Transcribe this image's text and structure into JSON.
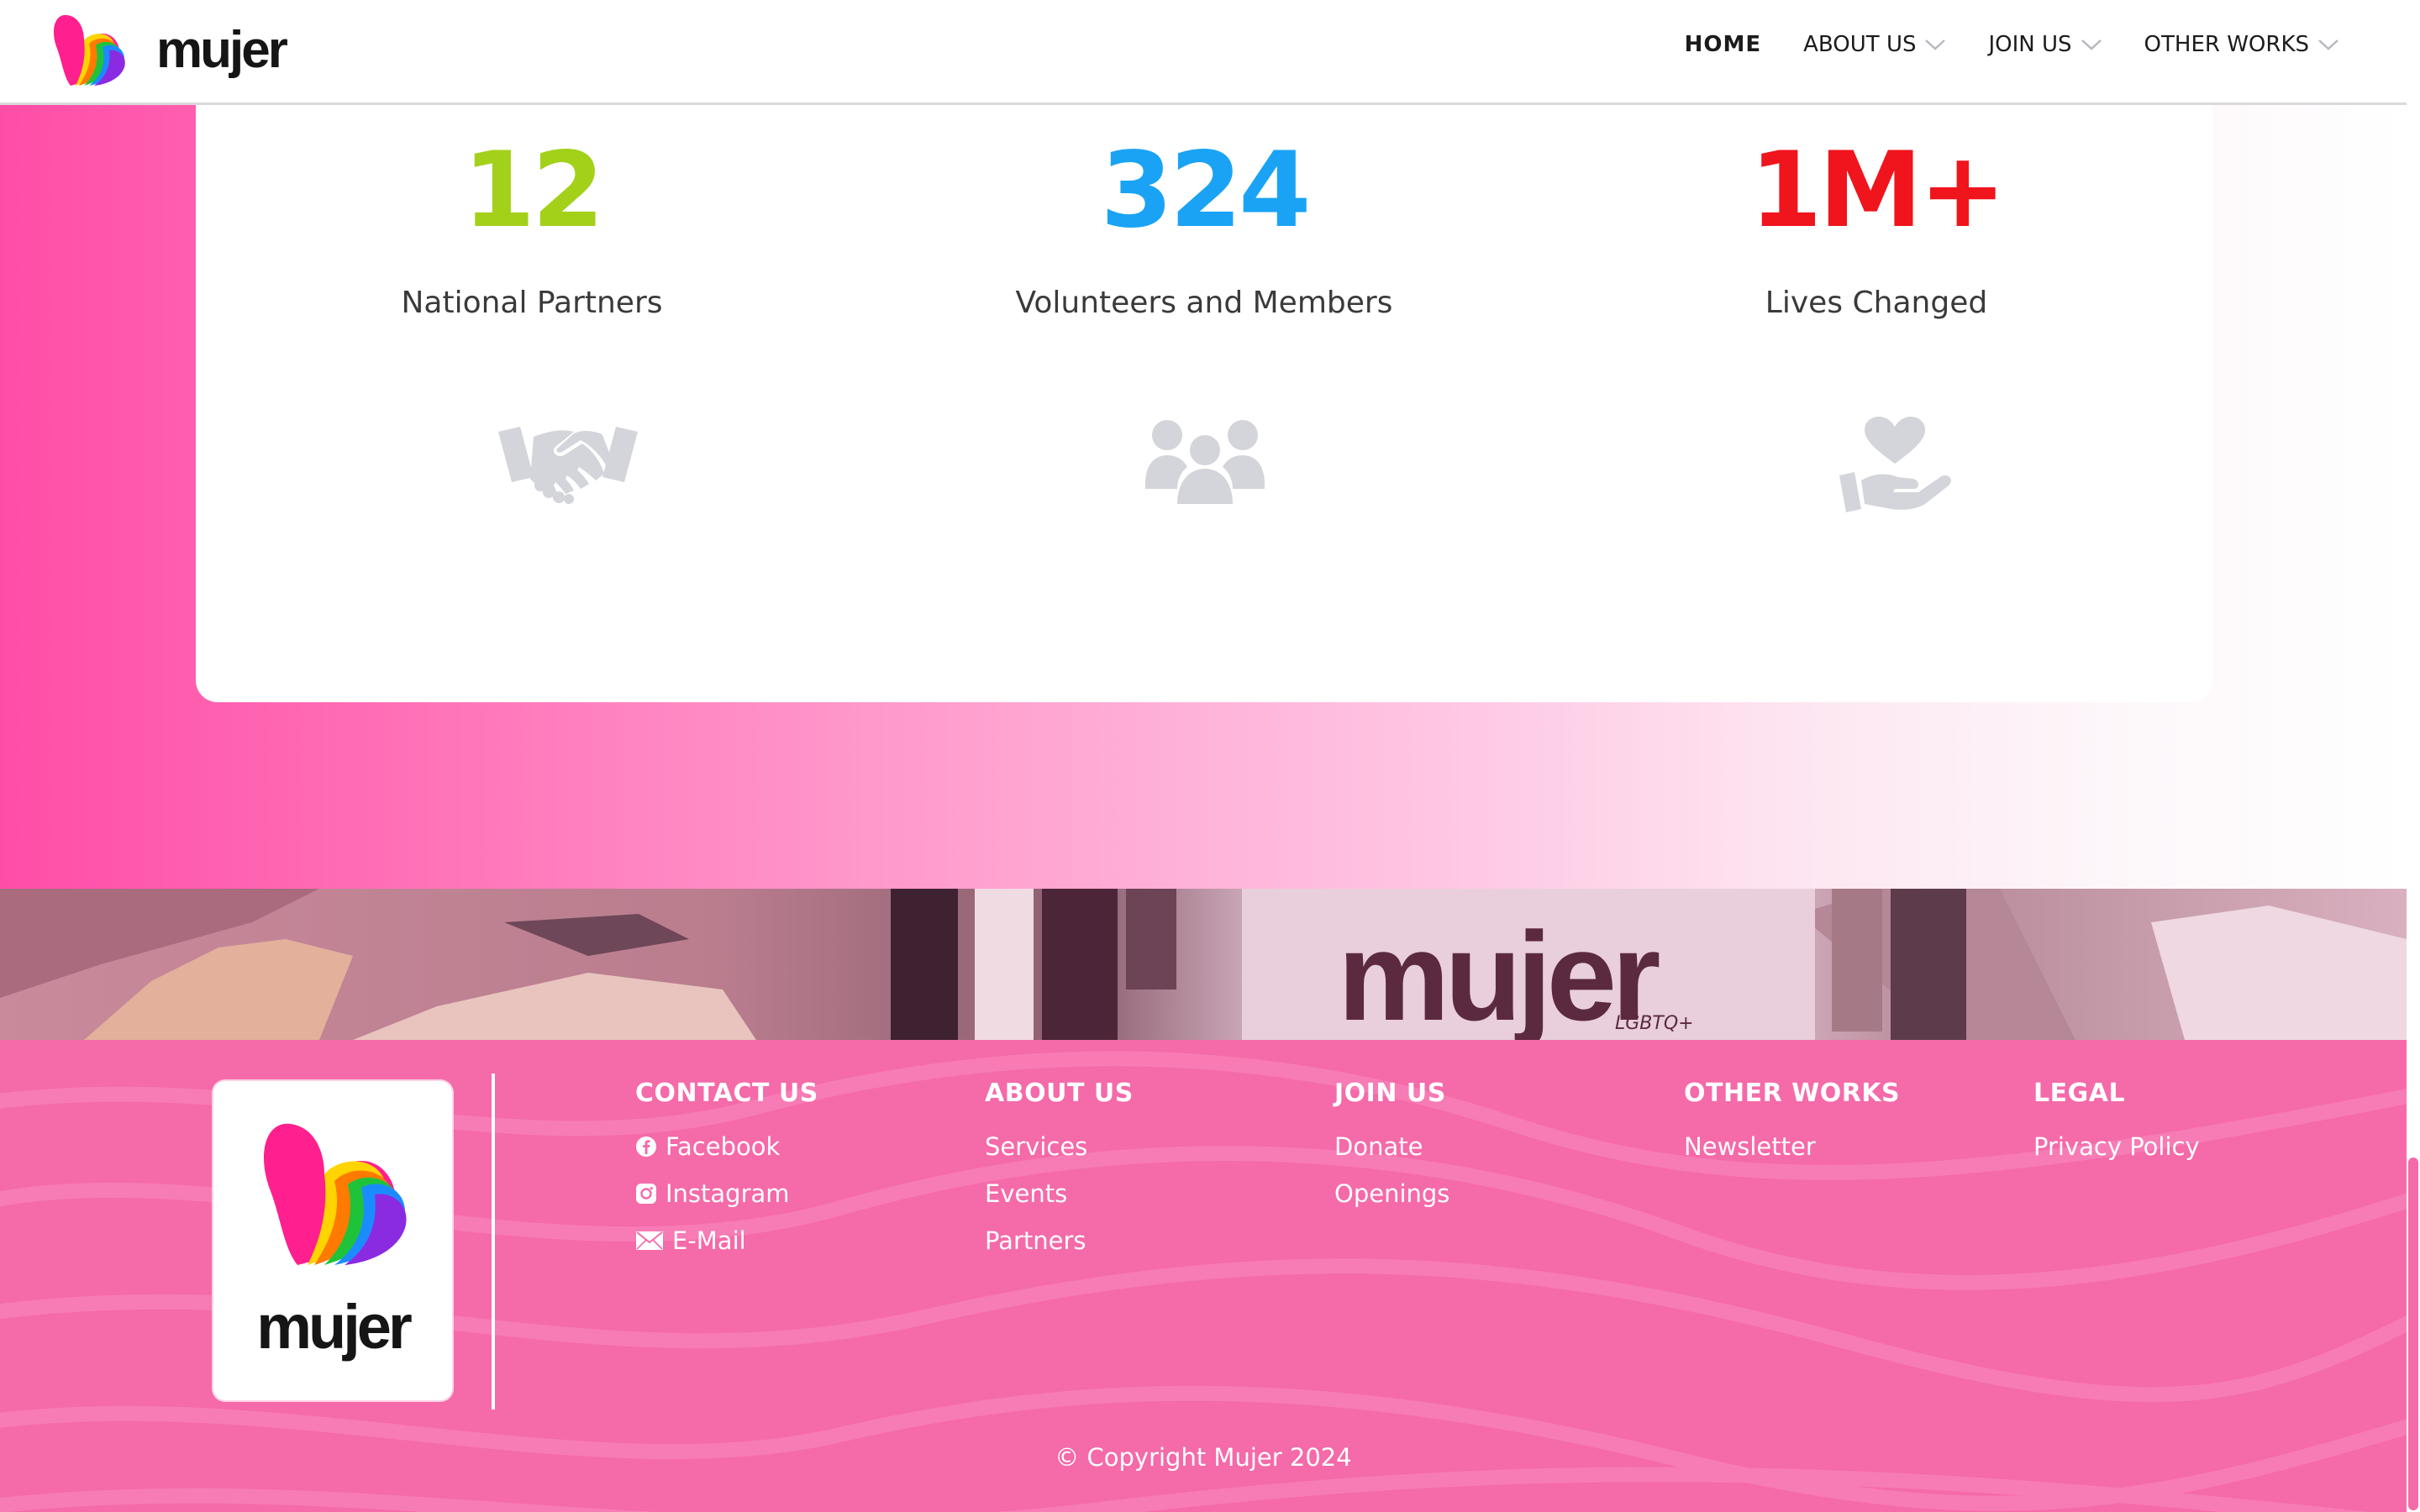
{
  "header": {
    "brand": "mujer",
    "nav": [
      {
        "label": "HOME",
        "active": true,
        "dropdown": false
      },
      {
        "label": "ABOUT US",
        "active": false,
        "dropdown": true
      },
      {
        "label": "JOIN US",
        "active": false,
        "dropdown": true
      },
      {
        "label": "OTHER WORKS",
        "active": false,
        "dropdown": true
      }
    ]
  },
  "stats": [
    {
      "number": "12",
      "label": "National Partners",
      "color": "#a3d11a",
      "icon": "handshake-icon"
    },
    {
      "number": "324",
      "label": "Volunteers and Members",
      "color": "#1aa3f5",
      "icon": "group-icon"
    },
    {
      "number": "1M+",
      "label": "Lives Changed",
      "color": "#f0141c",
      "icon": "heart-hand-icon"
    }
  ],
  "photo": {
    "banner_text": "mujer",
    "banner_sub": "LGBTQ+"
  },
  "footer": {
    "brand": "mujer",
    "columns": [
      {
        "title": "CONTACT US",
        "links": [
          {
            "label": "Facebook",
            "icon": "facebook-icon"
          },
          {
            "label": "Instagram",
            "icon": "instagram-icon"
          },
          {
            "label": "E-Mail",
            "icon": "mail-icon"
          }
        ]
      },
      {
        "title": "ABOUT US",
        "links": [
          {
            "label": "Services"
          },
          {
            "label": "Events"
          },
          {
            "label": "Partners"
          }
        ]
      },
      {
        "title": "JOIN US",
        "links": [
          {
            "label": "Donate"
          },
          {
            "label": "Openings"
          }
        ]
      },
      {
        "title": "OTHER WORKS",
        "links": [
          {
            "label": "Newsletter"
          }
        ]
      },
      {
        "title": "LEGAL",
        "links": [
          {
            "label": "Privacy Policy"
          }
        ]
      }
    ],
    "copyright": "© Copyright Mujer 2024"
  },
  "colors": {
    "pink_accent": "#ff4da6",
    "footer_pink": "#f56aa9",
    "icon_gray": "#d3d5da"
  }
}
